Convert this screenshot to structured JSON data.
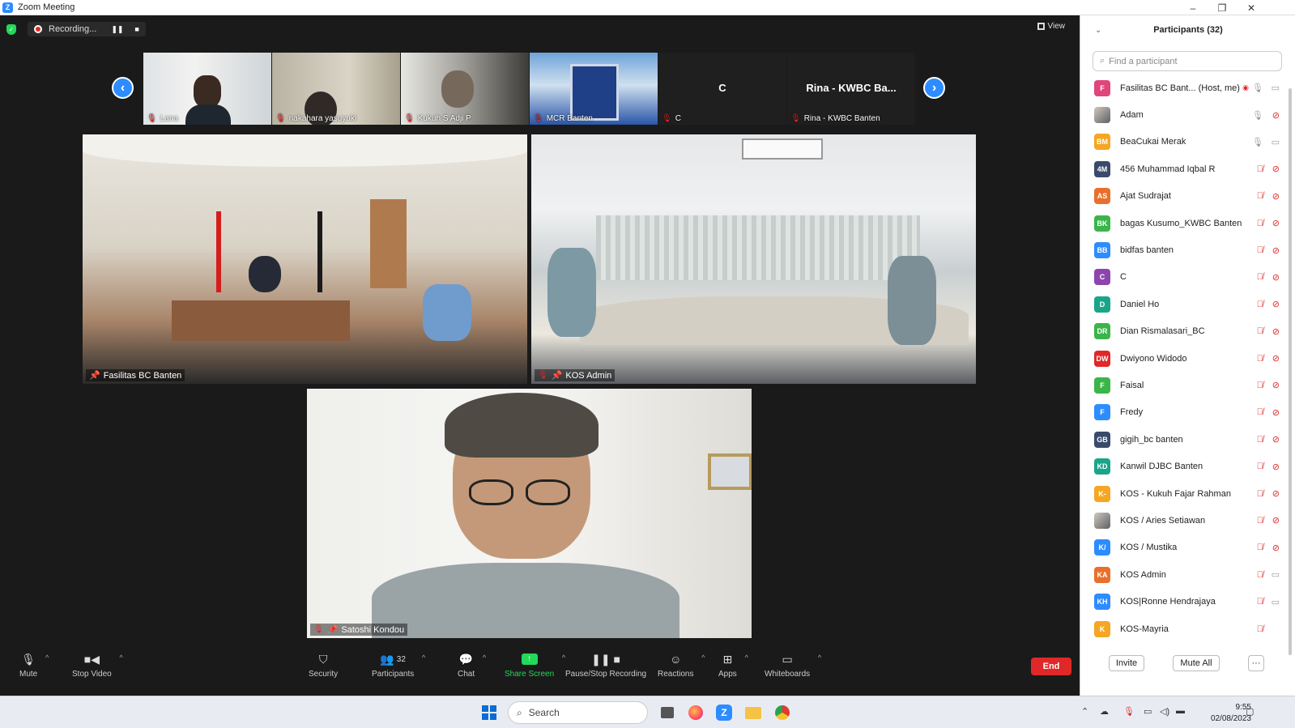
{
  "window": {
    "title": "Zoom Meeting",
    "controls": [
      "–",
      "❐",
      "✕"
    ]
  },
  "meeting": {
    "recording_label": "Recording...",
    "view_label": "View",
    "thumbnails": [
      {
        "name": "Lana",
        "muted": true
      },
      {
        "name": "nakahara yasuyuki",
        "muted": true
      },
      {
        "name": "Kukuh S Adji P",
        "muted": true
      },
      {
        "name": "MCR Banten",
        "muted": true
      },
      {
        "name": "C",
        "muted": true,
        "big": "C"
      },
      {
        "name": "Rina - KWBC Banten",
        "muted": true,
        "big": "Rina - KWBC Ba..."
      }
    ],
    "tiles": [
      {
        "name": "Fasilitas BC Banten"
      },
      {
        "name": "KOS Admin"
      },
      {
        "name": "Satoshi Kondou"
      }
    ]
  },
  "toolbar": {
    "mute": "Mute",
    "stop_video": "Stop Video",
    "security": "Security",
    "participants": "Participants",
    "participants_count": "32",
    "chat": "Chat",
    "share_screen": "Share Screen",
    "pause_recording": "Pause/Stop Recording",
    "reactions": "Reactions",
    "apps": "Apps",
    "whiteboards": "Whiteboards",
    "end": "End"
  },
  "panel": {
    "title": "Participants (32)",
    "search_placeholder": "Find a participant",
    "invite": "Invite",
    "mute_all": "Mute All",
    "more": "···",
    "participants": [
      {
        "initials": "F",
        "name": "Fasilitas BC Bant... (Host, me)",
        "color": "#e0457b",
        "mic": "on",
        "cam": "on",
        "rec": true
      },
      {
        "initials": "",
        "name": "Adam",
        "color": "#6b6b6b",
        "mic": "on",
        "cam": "off",
        "photo": true
      },
      {
        "initials": "BM",
        "name": "BeaCukai Merak",
        "color": "#f5a623",
        "mic": "on",
        "cam": "on"
      },
      {
        "initials": "4M",
        "name": "456 Muhammad Iqbal R",
        "color": "#3a4a6b",
        "mic": "off",
        "cam": "off"
      },
      {
        "initials": "AS",
        "name": "Ajat Sudrajat",
        "color": "#e8702a",
        "mic": "off",
        "cam": "off"
      },
      {
        "initials": "BK",
        "name": "bagas Kusumo_KWBC Banten",
        "color": "#3ab54a",
        "mic": "off",
        "cam": "off"
      },
      {
        "initials": "BB",
        "name": "bidfas banten",
        "color": "#2d8cff",
        "mic": "off",
        "cam": "off"
      },
      {
        "initials": "C",
        "name": "C",
        "color": "#8e44ad",
        "mic": "off",
        "cam": "off"
      },
      {
        "initials": "D",
        "name": "Daniel Ho",
        "color": "#1aa58a",
        "mic": "off",
        "cam": "off"
      },
      {
        "initials": "DR",
        "name": "Dian Rismalasari_BC",
        "color": "#3ab54a",
        "mic": "off",
        "cam": "off"
      },
      {
        "initials": "DW",
        "name": "Dwiyono Widodo",
        "color": "#e02828",
        "mic": "off",
        "cam": "off"
      },
      {
        "initials": "F",
        "name": "Faisal",
        "color": "#3ab54a",
        "mic": "off",
        "cam": "off"
      },
      {
        "initials": "F",
        "name": "Fredy",
        "color": "#2d8cff",
        "mic": "off",
        "cam": "off"
      },
      {
        "initials": "GB",
        "name": "gigih_bc banten",
        "color": "#3a4a6b",
        "mic": "off",
        "cam": "off"
      },
      {
        "initials": "KD",
        "name": "Kanwil DJBC Banten",
        "color": "#1aa58a",
        "mic": "off",
        "cam": "off"
      },
      {
        "initials": "K-",
        "name": "KOS - Kukuh Fajar Rahman",
        "color": "#f5a623",
        "mic": "off",
        "cam": "off"
      },
      {
        "initials": "",
        "name": "KOS / Aries Setiawan",
        "color": "#8890a0",
        "mic": "off",
        "cam": "off",
        "photo": true
      },
      {
        "initials": "K/",
        "name": "KOS / Mustika",
        "color": "#2d8cff",
        "mic": "off",
        "cam": "off"
      },
      {
        "initials": "KA",
        "name": "KOS Admin",
        "color": "#e8702a",
        "mic": "off",
        "cam": "on"
      },
      {
        "initials": "KH",
        "name": "KOS|Ronne Hendrajaya",
        "color": "#2d8cff",
        "mic": "off",
        "cam": "on"
      },
      {
        "initials": "K",
        "name": "KOS-Mayria",
        "color": "#f5a623",
        "mic": "off",
        "cam": "none"
      }
    ]
  },
  "taskbar": {
    "search": "Search",
    "time": "9:55",
    "date": "02/08/2023"
  }
}
